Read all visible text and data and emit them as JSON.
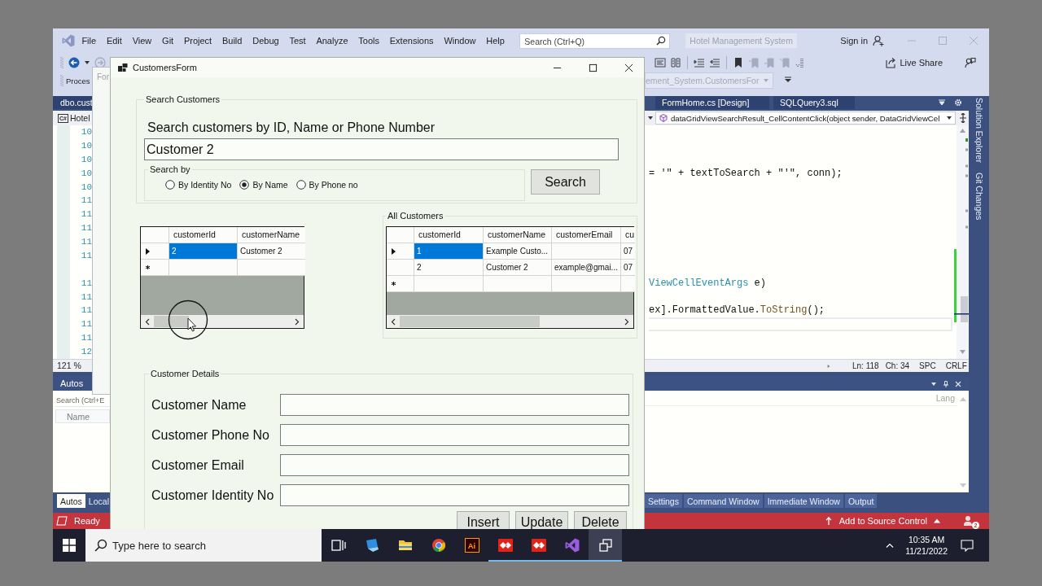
{
  "ide": {
    "menu": [
      "File",
      "Edit",
      "View",
      "Git",
      "Project",
      "Build",
      "Debug",
      "Test",
      "Analyze",
      "Tools",
      "Extensions",
      "Window",
      "Help"
    ],
    "search": {
      "placeholder": "Search (Ctrl+Q)"
    },
    "solution_name": "Hotel Management System",
    "sign_in": "Sign in",
    "process_label": "Proces",
    "live_share": "Live Share",
    "type_dropdown": {
      "value": "ement_System.CustomersFor",
      "disabled": true
    },
    "left_pane": {
      "document_tab": "dbo.cust",
      "language_badge": "C#",
      "project": "Hotel",
      "zoom": "121 %",
      "panel_title": "Autos",
      "panel_search": {
        "placeholder": "Search (Ctrl+E"
      },
      "panel_column": "Name",
      "panel_tabs": [
        {
          "label": "Autos",
          "selected": true
        },
        {
          "label": "Local",
          "selected": false
        }
      ]
    },
    "document_tabs": [
      "FormHome.cs [Design]",
      "SQLQuery3.sql"
    ],
    "member_dropdown": "dataGridViewSearchResult_CellContentClick(object sender, DataGridViewCel",
    "editor_lines": [
      {
        "kind": "line",
        "number": "10"
      },
      {
        "kind": "line",
        "number": "10"
      },
      {
        "kind": "line",
        "number": "10"
      },
      {
        "kind": "line",
        "number": "10",
        "code": [
          {
            "kind": "plain",
            "text": "= '\" + textToSearch + \"'\", conn);"
          }
        ]
      },
      {
        "kind": "line",
        "number": "10"
      },
      {
        "kind": "line",
        "number": "11"
      },
      {
        "kind": "line",
        "number": "11"
      },
      {
        "kind": "line",
        "number": "11"
      },
      {
        "kind": "line",
        "number": "11"
      },
      {
        "kind": "line",
        "number": "11"
      },
      {
        "kind": "codelens"
      },
      {
        "kind": "line",
        "number": "11",
        "code": [
          {
            "kind": "type",
            "text": "ViewCellEventArgs"
          },
          {
            "kind": "plain",
            "text": " e)"
          }
        ]
      },
      {
        "kind": "line",
        "number": "11"
      },
      {
        "kind": "line",
        "number": "11",
        "code": [
          {
            "kind": "plain",
            "text": "ex].FormattedValue."
          },
          {
            "kind": "method",
            "text": "ToString"
          },
          {
            "kind": "plain",
            "text": "();"
          }
        ]
      },
      {
        "kind": "line",
        "number": "11",
        "current": true
      },
      {
        "kind": "line",
        "number": "11"
      },
      {
        "kind": "line",
        "number": "12"
      }
    ],
    "editor_status": {
      "line": "Ln: 118",
      "column": "Ch: 34",
      "indent": "SPC",
      "line_ending": "CRLF"
    },
    "panel_column": "Lang",
    "panel_tabs": [
      {
        "label": "Settings",
        "selected": false
      },
      {
        "label": "Command Window",
        "selected": false
      },
      {
        "label": "Immediate Window",
        "selected": false
      },
      {
        "label": "Output",
        "selected": false
      }
    ],
    "side_tabs": [
      "Solution Explorer",
      "Git Changes"
    ],
    "status_bar": {
      "text": "Ready",
      "source_control": "Add to Source Control",
      "notification_count": "2"
    }
  },
  "background_window": {
    "title": "For"
  },
  "customers_form": {
    "title": "CustomersForm",
    "search_group": {
      "title": "Search Customers",
      "prompt": "Search customers by ID, Name or Phone Number",
      "query": "Customer 2",
      "search_by": {
        "title": "Search by",
        "options": [
          {
            "label": "By Identity No",
            "selected": false
          },
          {
            "label": "By Name",
            "selected": true
          },
          {
            "label": "By Phone no",
            "selected": false
          }
        ]
      },
      "button": "Search"
    },
    "result_grid": {
      "columns": [
        "customerId",
        "customerName"
      ],
      "rows": [
        {
          "kind": "current",
          "cells": [
            {
              "text": "2",
              "selected": true
            },
            {
              "text": "Customer 2",
              "selected": false
            }
          ]
        },
        {
          "kind": "new",
          "cells": [
            {
              "selected": false
            },
            {
              "selected": false
            }
          ]
        }
      ]
    },
    "all_customers": {
      "title": "All Customers",
      "columns": [
        "customerId",
        "customerName",
        "customerEmail",
        "cu"
      ],
      "rows": [
        {
          "kind": "current",
          "cells": [
            {
              "text": "1",
              "selected": true
            },
            {
              "text": "Example Custo...",
              "selected": false
            },
            {
              "selected": false
            },
            {
              "text": "07",
              "selected": false
            }
          ]
        },
        {
          "kind": "plain",
          "cells": [
            {
              "text": "2",
              "selected": false
            },
            {
              "text": "Customer 2",
              "selected": false
            },
            {
              "text": "example@gmai...",
              "selected": false
            },
            {
              "text": "07",
              "selected": false
            }
          ]
        },
        {
          "kind": "new",
          "cells": [
            {
              "selected": false
            },
            {
              "selected": false
            },
            {
              "selected": false
            },
            {
              "selected": false
            }
          ]
        }
      ]
    },
    "details": {
      "title": "Customer Details",
      "fields": [
        "Customer Name",
        "Customer Phone No",
        "Customer Email",
        "Customer Identity No"
      ],
      "buttons": [
        "Insert",
        "Update",
        "Delete"
      ]
    }
  },
  "taskbar": {
    "search_placeholder": "Type here to search",
    "apps": [
      {
        "kind": "task_view",
        "running": false,
        "selected": false
      },
      {
        "kind": "desktop_app",
        "running": false,
        "selected": false
      },
      {
        "kind": "folder",
        "running": false,
        "selected": false
      },
      {
        "kind": "browser",
        "running": false,
        "selected": false
      },
      {
        "kind": "text_tile",
        "label": "Ai",
        "running": false,
        "selected": false
      },
      {
        "kind": "diamond",
        "running": true,
        "selected": false
      },
      {
        "kind": "diamond",
        "running": true,
        "selected": false
      },
      {
        "kind": "ribbon",
        "running": true,
        "selected": false
      },
      {
        "kind": "windows",
        "running": true,
        "selected": true
      }
    ],
    "time": "10:35 AM",
    "date": "11/21/2022"
  }
}
